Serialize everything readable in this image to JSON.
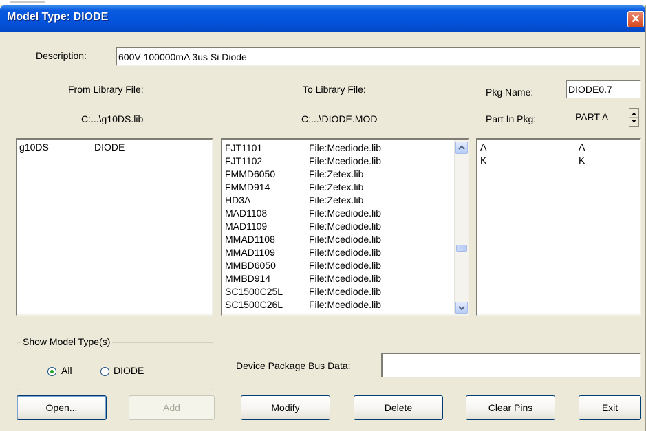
{
  "window": {
    "title": "Model Type: DIODE",
    "close_glyph": "✕"
  },
  "description": {
    "label": "Description:",
    "value": "600V 100000mA 3us Si Diode"
  },
  "from_library": {
    "label": "From Library File:",
    "path": "C:...\\g10DS.lib"
  },
  "to_library": {
    "label": "To Library File:",
    "path": "C:...\\DIODE.MOD"
  },
  "pkg": {
    "name_label": "Pkg Name:",
    "name_value": "DIODE0.7",
    "part_label": "Part In Pkg:",
    "part_value": "PART A"
  },
  "from_list": [
    {
      "name": "g10DS",
      "type": "DIODE"
    }
  ],
  "to_list": [
    {
      "name": "FJT1101",
      "file": "File:Mcediode.lib"
    },
    {
      "name": "FJT1102",
      "file": "File:Mcediode.lib"
    },
    {
      "name": "FMMD6050",
      "file": "File:Zetex.lib"
    },
    {
      "name": "FMMD914",
      "file": "File:Zetex.lib"
    },
    {
      "name": "HD3A",
      "file": "File:Zetex.lib"
    },
    {
      "name": "MAD1108",
      "file": "File:Mcediode.lib"
    },
    {
      "name": "MAD1109",
      "file": "File:Mcediode.lib"
    },
    {
      "name": "MMAD1108",
      "file": "File:Mcediode.lib"
    },
    {
      "name": "MMAD1109",
      "file": "File:Mcediode.lib"
    },
    {
      "name": "MMBD6050",
      "file": "File:Mcediode.lib"
    },
    {
      "name": "MMBD914",
      "file": "File:Mcediode.lib"
    },
    {
      "name": "SC1500C25L",
      "file": "File:Mcediode.lib"
    },
    {
      "name": "SC1500C26L",
      "file": "File:Mcediode.lib"
    }
  ],
  "pins": [
    {
      "name": "A",
      "map": "A"
    },
    {
      "name": "K",
      "map": "K"
    }
  ],
  "show_model": {
    "legend": "Show Model Type(s)",
    "all_label": "All",
    "diode_label": "DIODE",
    "selected": "All"
  },
  "bus_data": {
    "label": "Device Package Bus Data:",
    "value": ""
  },
  "buttons": {
    "open": "Open...",
    "add": "Add",
    "modify": "Modify",
    "delete": "Delete",
    "clear_pins": "Clear Pins",
    "exit": "Exit"
  },
  "colors": {
    "title_bar": "#0453dc",
    "dialog_bg": "#ece9d8",
    "close": "#d4471d",
    "radio_dot": "#21a121"
  }
}
